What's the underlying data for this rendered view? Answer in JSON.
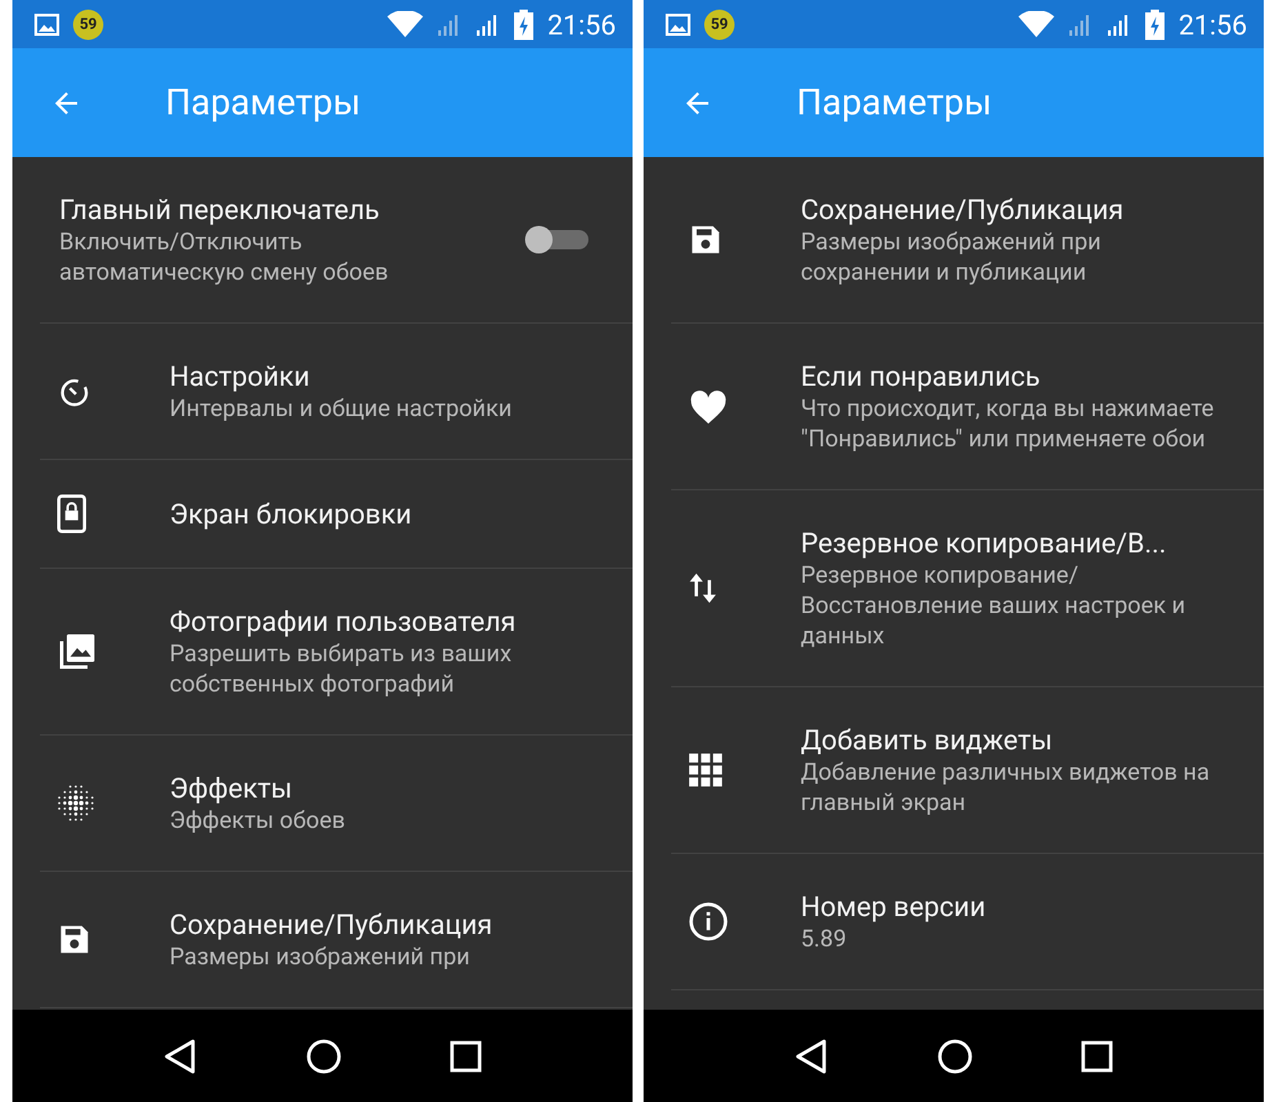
{
  "screens": [
    {
      "status_bar": {
        "badge": "59",
        "time": "21:56"
      },
      "app_bar": {
        "title": "Параметры"
      },
      "items": [
        {
          "kind": "switch",
          "title": "Главный переключатель",
          "subtitle": "Включить/Отключить автоматическую смену обоев",
          "on": false
        },
        {
          "kind": "timer",
          "title": "Настройки",
          "subtitle": "Интервалы и общие настройки"
        },
        {
          "kind": "lock",
          "title": "Экран блокировки"
        },
        {
          "kind": "photos",
          "title": "Фотографии пользователя",
          "subtitle": "Разрешить выбирать из ваших собственных фотографий"
        },
        {
          "kind": "effects",
          "title": "Эффекты",
          "subtitle": "Эффекты обоев"
        },
        {
          "kind": "save",
          "title": "Сохранение/Публикация",
          "subtitle": "Размеры изображений при"
        }
      ]
    },
    {
      "status_bar": {
        "badge": "59",
        "time": "21:56"
      },
      "app_bar": {
        "title": "Параметры"
      },
      "items": [
        {
          "kind": "save",
          "title": "Сохранение/Публикация",
          "subtitle": "Размеры изображений при сохранении и публикации"
        },
        {
          "kind": "heart",
          "title": "Если понравились",
          "subtitle": "Что происходит, когда вы нажимаете \"Понравились\" или применяете обои"
        },
        {
          "kind": "backup",
          "title": "Резервное копирование/В...",
          "subtitle": "Резервное копирование/ Восстановление ваших настроек и данных"
        },
        {
          "kind": "widgets",
          "title": "Добавить виджеты",
          "subtitle": "Добавление различных виджетов на главный экран"
        },
        {
          "kind": "info",
          "title": "Номер версии",
          "subtitle": "5.89"
        }
      ]
    }
  ]
}
